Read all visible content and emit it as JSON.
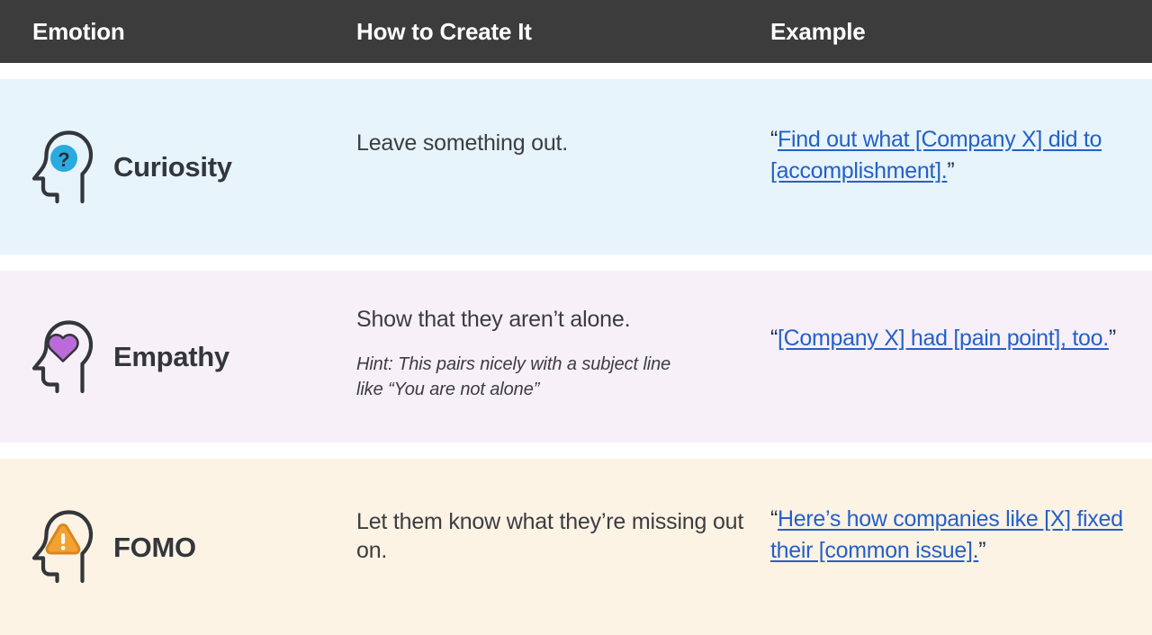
{
  "header": {
    "columns": [
      {
        "label": "Emotion"
      },
      {
        "label": "How to Create It"
      },
      {
        "label": "Example"
      }
    ]
  },
  "colors": {
    "header_bg": "#3c3c3c",
    "header_text": "#ffffff",
    "row_curiosity_bg": "#e7f4fb",
    "row_empathy_bg": "#f7f0f9",
    "row_fomo_bg": "#fdf3e4",
    "link_blue": "#2560c8",
    "body_text": "#3b3d42",
    "curiosity_accent": "#29abe2",
    "empathy_accent": "#bb6bd9",
    "fomo_accent": "#f2a233",
    "icon_stroke": "#33363b"
  },
  "rows": [
    {
      "emotion": "Curiosity",
      "icon": "head-question-icon",
      "accent": "#29abe2",
      "how_to": "Leave something out.",
      "hint": "",
      "example": {
        "open_quote": "“",
        "link": "Find out what [Company X] did to [accomplishment].",
        "close_quote": "”"
      }
    },
    {
      "emotion": "Empathy",
      "icon": "head-heart-icon",
      "accent": "#bb6bd9",
      "how_to": "Show that they aren’t alone.",
      "hint": "Hint: This pairs nicely with a subject line like “You are not alone”",
      "example": {
        "open_quote": "“",
        "link": "[Company X] had [pain point], too.",
        "close_quote": "”"
      }
    },
    {
      "emotion": "FOMO",
      "icon": "head-warning-icon",
      "accent": "#f2a233",
      "how_to": "Let them know what they’re missing out on.",
      "hint": "",
      "example": {
        "open_quote": "“",
        "link": "Here’s how companies like [X] fixed their [common issue].",
        "close_quote": "”"
      }
    }
  ]
}
